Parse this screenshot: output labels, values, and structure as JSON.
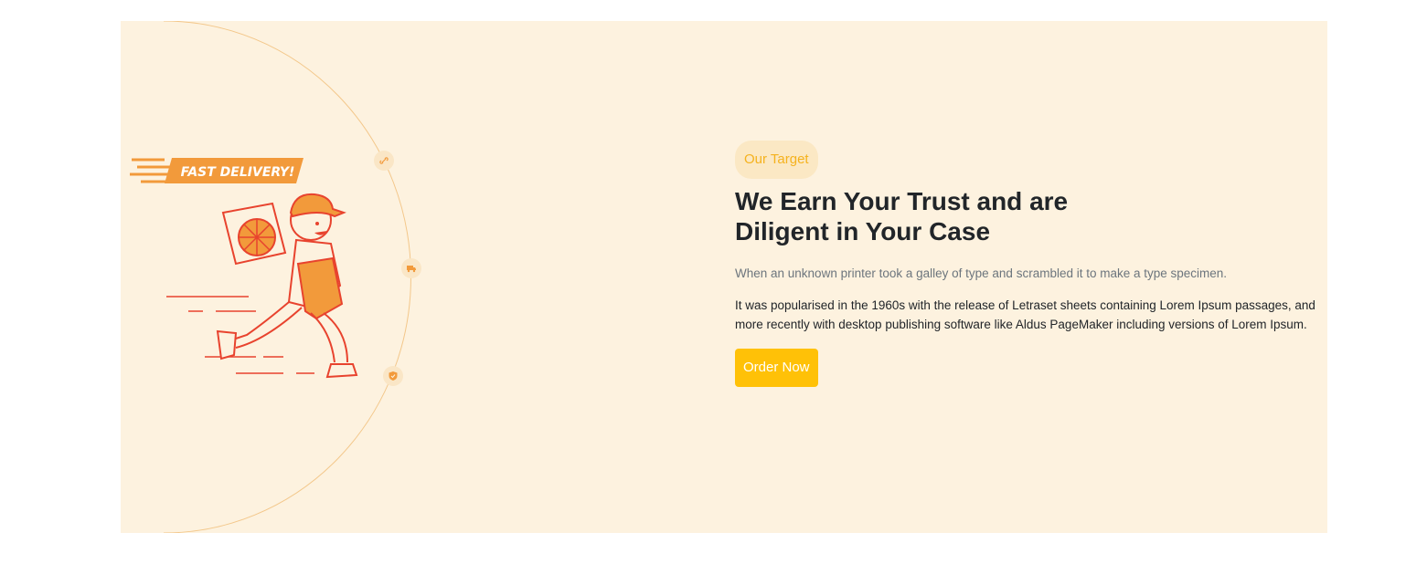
{
  "illustration": {
    "banner_text": "FAST DELIVERY!",
    "icons": [
      "link-icon",
      "truck-icon",
      "shield-icon"
    ]
  },
  "content": {
    "tag_label": "Our Target",
    "heading": "We Earn Your Trust and are Diligent in Your Case",
    "lead": "When an unknown printer took a galley of type and scrambled it to make a type specimen.",
    "body": "It was popularised in the 1960s with the release of Letraset sheets containing Lorem Ipsum passages, and more recently with desktop publishing software like Aldus PageMaker including versions of Lorem Ipsum.",
    "cta_label": "Order Now"
  },
  "colors": {
    "section_bg": "#fdf2df",
    "accent": "#ffc107",
    "tag_text": "#f5b21e",
    "illustration_red": "#e8432e",
    "illustration_orange": "#f29a3b"
  }
}
